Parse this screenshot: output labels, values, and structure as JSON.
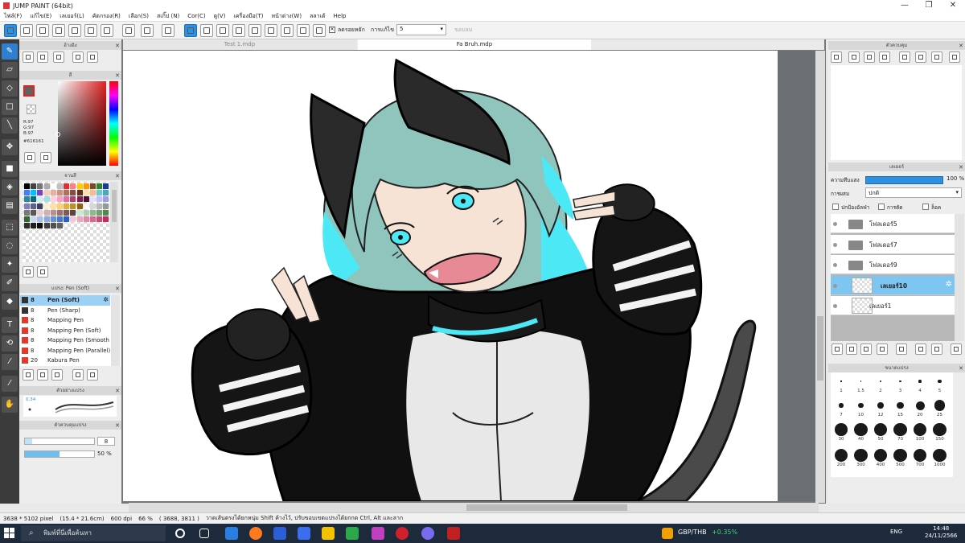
{
  "window": {
    "title": "JUMP PAINT (64bit)",
    "minimize": "—",
    "maximize": "❐",
    "close": "✕"
  },
  "menu": [
    "ไฟล์(F)",
    "แก้ไข(E)",
    "เลเยอร์(L)",
    "คัดกรอง(R)",
    "เลือก(S)",
    "สเกิ๊ป (N)",
    "Cor(C)",
    "ดู(V)",
    "เครื่องมือ(T)",
    "หน้าต่าง(W)",
    "ลลาเต้",
    "Help"
  ],
  "toolbar": {
    "check_label": "ลดรอยหยัก",
    "check_mark": "✕",
    "correction_label": "การแก้ไข",
    "correction_value": "5",
    "disabled_label": "ขอบลม",
    "dropdown_arrow": "▾"
  },
  "tabs": [
    "Test 1.mdp",
    "Fa Bruh.mdp"
  ],
  "panels": {
    "reference": "อ้างอิง",
    "color": "สี",
    "palette": "จานสี",
    "brush": "แปรง: Pen (Soft)",
    "stroke": "ตัวอย่างแปรง",
    "brush_control": "ตัวควบคุมแปรง",
    "navigator": "ตัวควบคุม",
    "layer": "เลเยอร์",
    "brush_size": "ขนาดแปรง",
    "close_icon": "✕"
  },
  "color": {
    "r": "R:97",
    "g": "G:97",
    "b": "B:97",
    "hex": "#616161",
    "fg": "#616161",
    "accent": "#2f8fe0"
  },
  "palette_colors": [
    "#000000",
    "#444444",
    "#777777",
    "#aaaaaa",
    "#ffffff",
    "#c0c0c0",
    "#e03030",
    "#ff8080",
    "#ffcc00",
    "#ff9900",
    "#7a4a2a",
    "#2a8a2a",
    "#1a3aa0",
    "#4080ff",
    "#00c0ff",
    "#8040c0",
    "#f0d0c0",
    "#e8b0a0",
    "#d09080",
    "#b07060",
    "#805040",
    "#603020",
    "#ffe0b0",
    "#f0c090",
    "#6ec8d0",
    "#4aa8b8",
    "#2a8898",
    "#0a6878",
    "#d0f0f0",
    "#a0e0e0",
    "#ffd0e0",
    "#ffa0c0",
    "#e070a0",
    "#b04070",
    "#802050",
    "#501030",
    "#e0e0ff",
    "#c0c0ff",
    "#a0a0e0",
    "#8080c0",
    "#606090",
    "#404060",
    "#fff0d0",
    "#ffe0a0",
    "#ffd070",
    "#e0b040",
    "#c09020",
    "#906010",
    "#f8f8f8",
    "#d8d8d8",
    "#b8b8b8",
    "#989898",
    "#787878",
    "#585858",
    "#e8d0d0",
    "#d0b0b0",
    "#b89090",
    "#a07070",
    "#805858",
    "#604040",
    "#d0e8d0",
    "#b0d0b0",
    "#90b890",
    "#70a070",
    "#508850",
    "#306830",
    "#c8d8f0",
    "#a8c0e8",
    "#88a8e0",
    "#6890d8",
    "#4878d0",
    "#2860c8",
    "#f0c8d8",
    "#e8a8c0",
    "#e088a8",
    "#d86890",
    "#d04878",
    "#c82860",
    "#303030",
    "#202020",
    "#101010",
    "#404040",
    "#505050",
    "#606060"
  ],
  "brushes": [
    {
      "size": "8",
      "name": "Pen (Soft)",
      "selected": true
    },
    {
      "size": "8",
      "name": "Pen (Sharp)",
      "selected": false
    },
    {
      "size": "8",
      "name": "Mapping Pen",
      "selected": false
    },
    {
      "size": "8",
      "name": "Mapping Pen (Soft)",
      "selected": false
    },
    {
      "size": "8",
      "name": "Mapping Pen (Smooth",
      "selected": false
    },
    {
      "size": "8",
      "name": "Mapping Pen (Parallel)",
      "selected": false
    },
    {
      "size": "20",
      "name": "Kabura Pen",
      "selected": false
    }
  ],
  "stroke_preview": "0.34",
  "brush_control": {
    "size": "8",
    "opacity": "50 %",
    "size_level": 0.1,
    "opacity_level": 0.5
  },
  "layer_panel": {
    "opacity_label": "ความทึบแสง",
    "opacity_value": "100 %",
    "opacity_level": 1.0,
    "blend_label": "การผสม",
    "blend_value": "ปกติ",
    "protect_alpha": "ปกป้องอัลฟ่า",
    "clipping": "การตัด",
    "lock": "ล็อค",
    "layers": [
      {
        "name": "โฟลเดอร์5",
        "type": "folder",
        "selected": false
      },
      {
        "name": "โฟลเดอร์7",
        "type": "folder",
        "selected": false
      },
      {
        "name": "โฟลเดอร์9",
        "type": "folder",
        "selected": false
      },
      {
        "name": "เลเยอร์10",
        "type": "layer",
        "selected": true
      },
      {
        "name": "เลเยอร์1",
        "type": "layer",
        "selected": false
      }
    ]
  },
  "brush_sizes": [
    {
      "label": "1",
      "d": 1
    },
    {
      "label": "1.5",
      "d": 1.5
    },
    {
      "label": "2",
      "d": 2
    },
    {
      "label": "3",
      "d": 2.5
    },
    {
      "label": "4",
      "d": 3
    },
    {
      "label": "5",
      "d": 4
    },
    {
      "label": "7",
      "d": 5
    },
    {
      "label": "10",
      "d": 6
    },
    {
      "label": "12",
      "d": 7
    },
    {
      "label": "15",
      "d": 8
    },
    {
      "label": "20",
      "d": 10
    },
    {
      "label": "25",
      "d": 12
    },
    {
      "label": "30",
      "d": 14
    },
    {
      "label": "40",
      "d": 15
    },
    {
      "label": "50",
      "d": 15
    },
    {
      "label": "70",
      "d": 15
    },
    {
      "label": "100",
      "d": 15
    },
    {
      "label": "150",
      "d": 15
    },
    {
      "label": "200",
      "d": 15
    },
    {
      "label": "300",
      "d": 15
    },
    {
      "label": "400",
      "d": 15
    },
    {
      "label": "500",
      "d": 15
    },
    {
      "label": "700",
      "d": 15
    },
    {
      "label": "1000",
      "d": 15
    }
  ],
  "status": {
    "dims": "3638 * 5102 pixel",
    "cm": "(15.4 * 21.6cm)",
    "dpi": "600 dpi",
    "zoom": "66 %",
    "coords": "( 3688, 3811 )",
    "hint": "วาดเส้นตรงได้ยกหนุ่ม Shift ค้างไว้, ปรับขอบเขตแปรงได้ยกกด Ctrl, Alt และลาก"
  },
  "taskbar": {
    "search": "พิมพ์ที่นี่เพื่อค้นหา",
    "ticker": "GBP/THB",
    "ticker_change": "+0.35%",
    "lang": "ENG",
    "time": "14:48",
    "date": "24/11/2566"
  }
}
